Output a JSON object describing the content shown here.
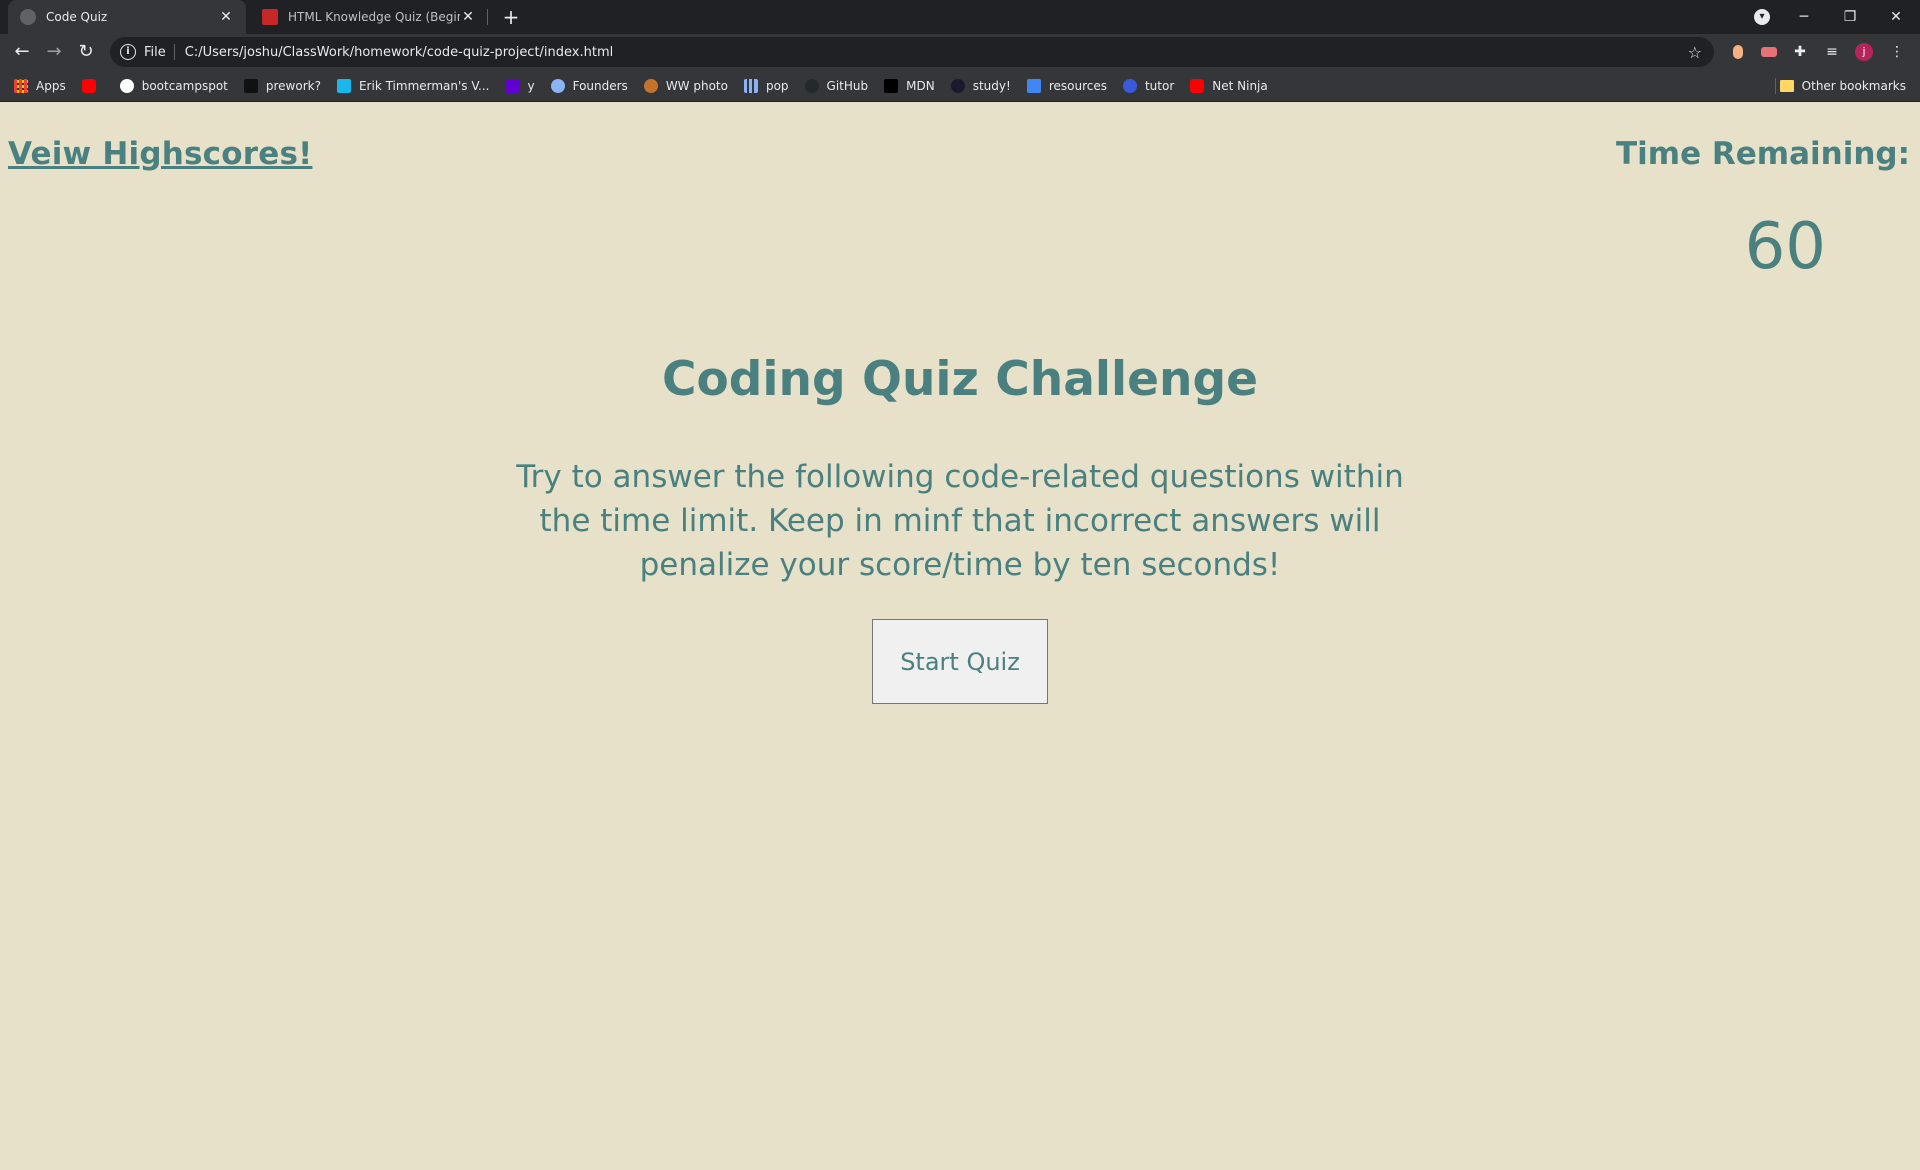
{
  "browser": {
    "tabs": [
      {
        "title": "Code Quiz",
        "active": true
      },
      {
        "title": "HTML Knowledge Quiz (Beginner",
        "active": false
      }
    ],
    "new_tab": "+",
    "window_controls": {
      "minimize": "─",
      "restore": "❐",
      "close": "✕"
    },
    "address": {
      "scheme": "File",
      "url": "C:/Users/joshu/ClassWork/homework/code-quiz-project/index.html"
    },
    "bookmarks": [
      {
        "label": "Apps",
        "icon_color": "#ea4335"
      },
      {
        "label": "",
        "icon_color": "#ff0000"
      },
      {
        "label": "bootcampspot",
        "icon_color": "#ffffff"
      },
      {
        "label": "prework?",
        "icon_color": "#202124"
      },
      {
        "label": "Erik Timmerman's V...",
        "icon_color": "#1ab7ea"
      },
      {
        "label": "y",
        "icon_color": "#6001d2"
      },
      {
        "label": "Founders",
        "icon_color": "#8ab4f8"
      },
      {
        "label": "WW photo",
        "icon_color": "#c4732d"
      },
      {
        "label": "pop",
        "icon_color": "#8ab4f8"
      },
      {
        "label": "GitHub",
        "icon_color": "#24292e"
      },
      {
        "label": "MDN",
        "icon_color": "#000000"
      },
      {
        "label": "study!",
        "icon_color": "#1a1a2e"
      },
      {
        "label": "resources",
        "icon_color": "#4285f4"
      },
      {
        "label": "tutor",
        "icon_color": "#3a5bd9"
      },
      {
        "label": "Net Ninja",
        "icon_color": "#ff0000"
      }
    ],
    "other_bookmarks": "Other bookmarks",
    "profile_initial": "j"
  },
  "page": {
    "highscores_link": "Veiw Highscores!",
    "time_label": "Time Remaining:",
    "time_value": "60",
    "title": "Coding Quiz Challenge",
    "description": "Try to answer the following code-related questions within the time limit. Keep in minf that incorrect answers will penalize your score/time by ten seconds!",
    "start_button": "Start Quiz"
  },
  "colors": {
    "page_background": "#e6e1c8",
    "accent_text": "#4a8080",
    "chrome_dark": "#202124",
    "chrome_mid": "#35363a"
  }
}
